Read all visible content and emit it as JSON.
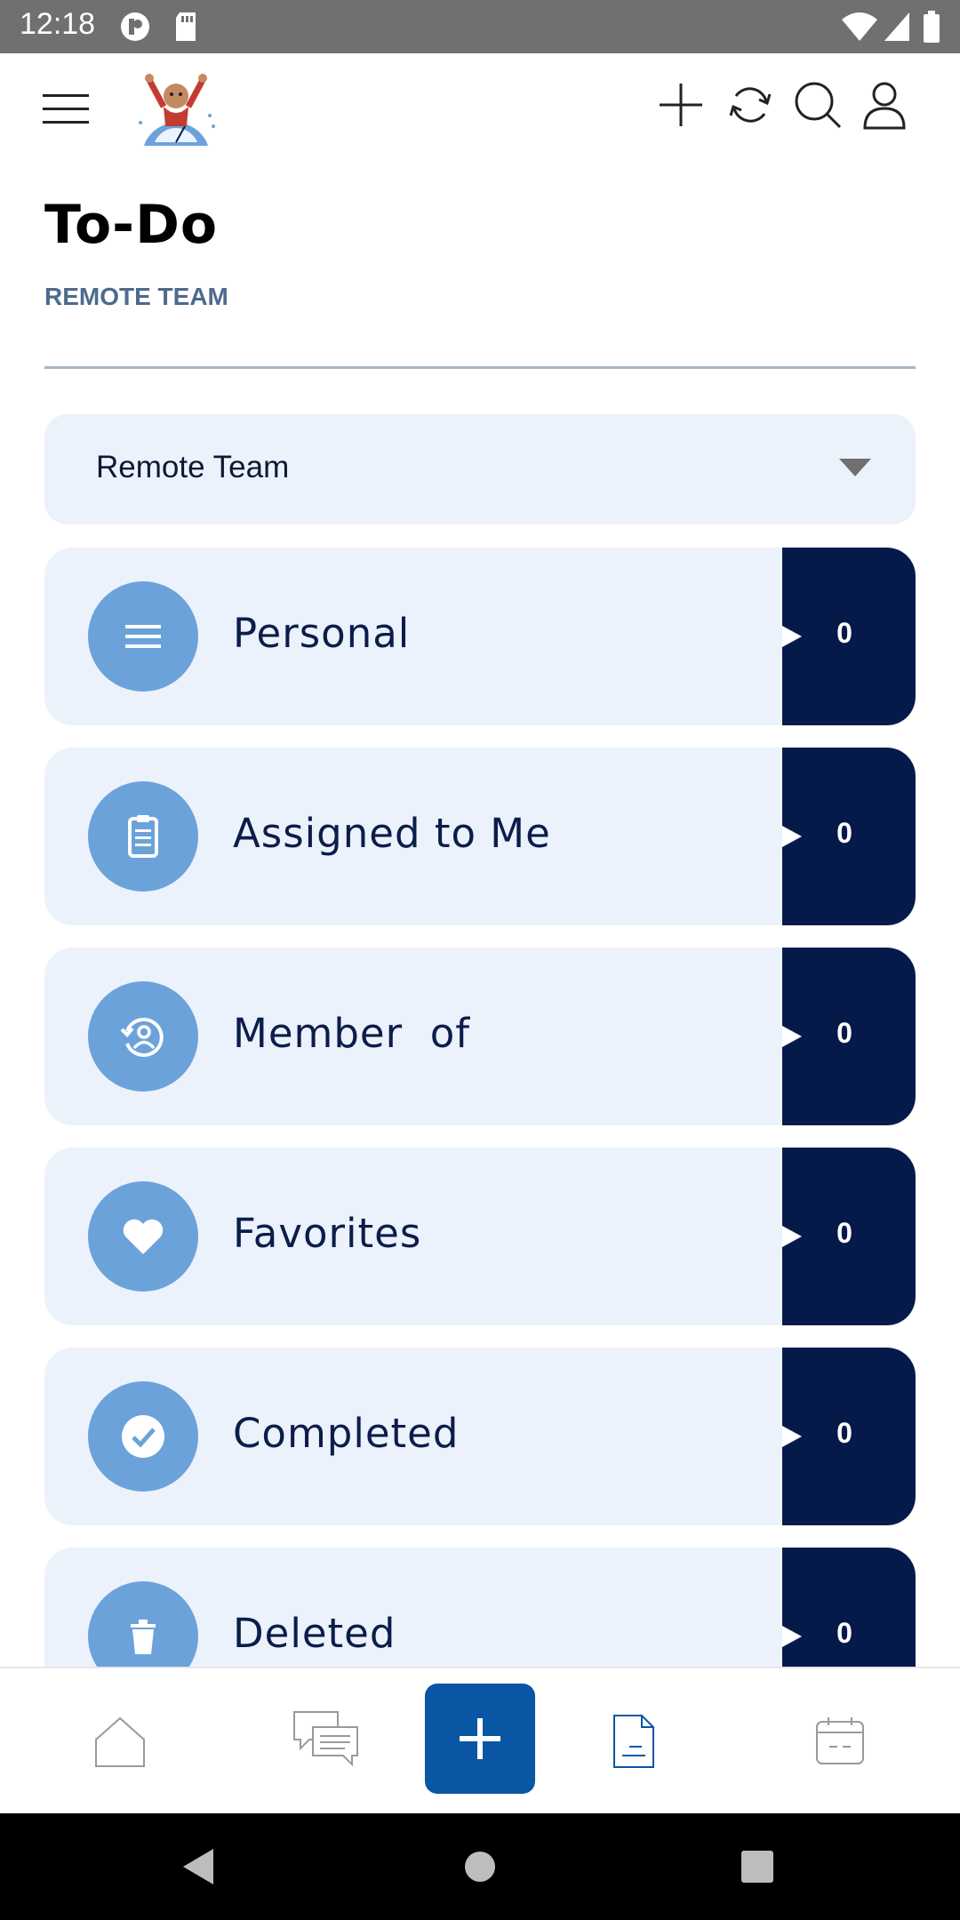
{
  "status_bar": {
    "time": "12:18",
    "left_icons": [
      "app-notification-icon",
      "sd-card-icon"
    ],
    "right_icons": [
      "wifi-icon",
      "cell-signal-icon",
      "battery-icon"
    ]
  },
  "header": {
    "menu_icon": "hamburger-menu-icon",
    "logo": "app-logo",
    "actions": [
      "add-icon",
      "sync-icon",
      "search-icon",
      "profile-icon"
    ]
  },
  "page": {
    "title": "To-Do",
    "subtitle": "REMOTE TEAM"
  },
  "team_select": {
    "value": "Remote Team"
  },
  "categories": [
    {
      "label": "Personal",
      "count": "0",
      "icon": "list-icon"
    },
    {
      "label": "Assigned to Me",
      "count": "0",
      "icon": "clipboard-icon"
    },
    {
      "label": "Member  of",
      "count": "0",
      "icon": "user-history-icon"
    },
    {
      "label": "Favorites",
      "count": "0",
      "icon": "heart-icon"
    },
    {
      "label": "Completed",
      "count": "0",
      "icon": "check-icon"
    },
    {
      "label": "Deleted",
      "count": "0",
      "icon": "trash-icon"
    }
  ],
  "bottom_nav": {
    "items": [
      "home-icon",
      "chat-icon",
      "add-icon",
      "document-icon",
      "calendar-icon"
    ],
    "active": "document-icon"
  },
  "colors": {
    "card_bg": "#ecf2fb",
    "icon_circle": "#6ca2da",
    "count_box": "#061a4a",
    "accent": "#0a56a5",
    "subtitle": "#4e6a8d"
  }
}
